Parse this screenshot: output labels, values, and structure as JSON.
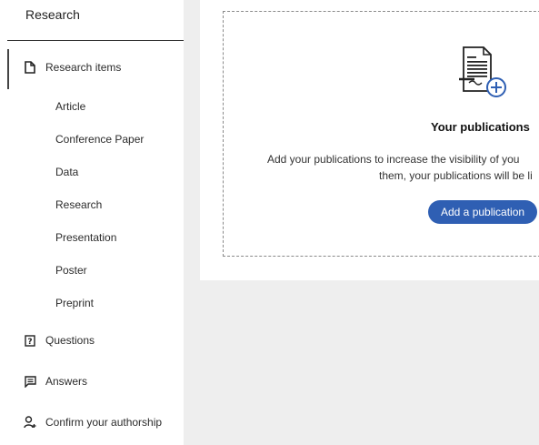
{
  "sidebar": {
    "title": "Research",
    "research_items": {
      "label": "Research items",
      "icon": "document-icon"
    },
    "sub_items": [
      "Article",
      "Conference Paper",
      "Data",
      "Research",
      "Presentation",
      "Poster",
      "Preprint"
    ],
    "questions": {
      "label": "Questions",
      "icon": "question-icon"
    },
    "answers": {
      "label": "Answers",
      "icon": "answer-icon"
    },
    "confirm": {
      "label": "Confirm your authorship",
      "icon": "person-add-icon"
    }
  },
  "main": {
    "empty_state": {
      "icon": "document-add-icon",
      "title": "Your publications",
      "description_line1": "Add your publications to increase the visibility of you",
      "description_line2": "them, your publications will be li",
      "button_label": "Add a publication"
    }
  },
  "colors": {
    "accent": "#2f5fb3",
    "sidebar_bg": "#ffffff",
    "page_bg": "#eeeeee"
  }
}
